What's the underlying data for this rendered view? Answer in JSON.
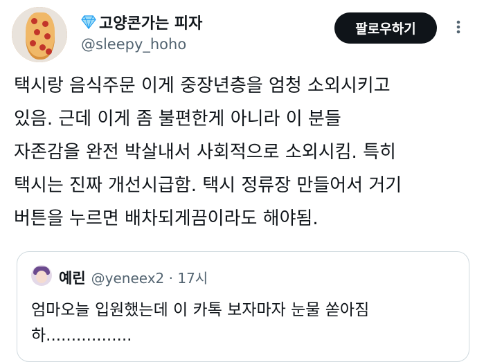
{
  "author": {
    "display_name": "고양콘가는 피자",
    "badge_icon": "diamond-icon",
    "handle": "@sleepy_hoho"
  },
  "follow_label": "팔로우하기",
  "more_icon": "more-icon",
  "tweet": {
    "lines": [
      "택시랑 음식주문 이게 중장년층을 엄청 소외시키고",
      "있음. 근데 이게 좀 불편한게 아니라 이 분들",
      "자존감을 완전 박살내서 사회적으로 소외시킴. 특히",
      "택시는 진짜 개선시급함. 택시 정류장 만들어서 거기",
      "버튼을 누르면 배차되게끔이라도 해야됨."
    ]
  },
  "quote": {
    "display_name": "예린",
    "handle_time": "@yeneex2 · 17시",
    "lines": [
      "엄마오늘 입원했는데 이 카톡 보자마자 눈물 쏟아짐",
      "하................."
    ]
  },
  "colors": {
    "text": "#0f1419",
    "secondary": "#536471",
    "button_bg": "#0f1419",
    "border": "#cfd9de",
    "badge": "#1d9bf0"
  }
}
